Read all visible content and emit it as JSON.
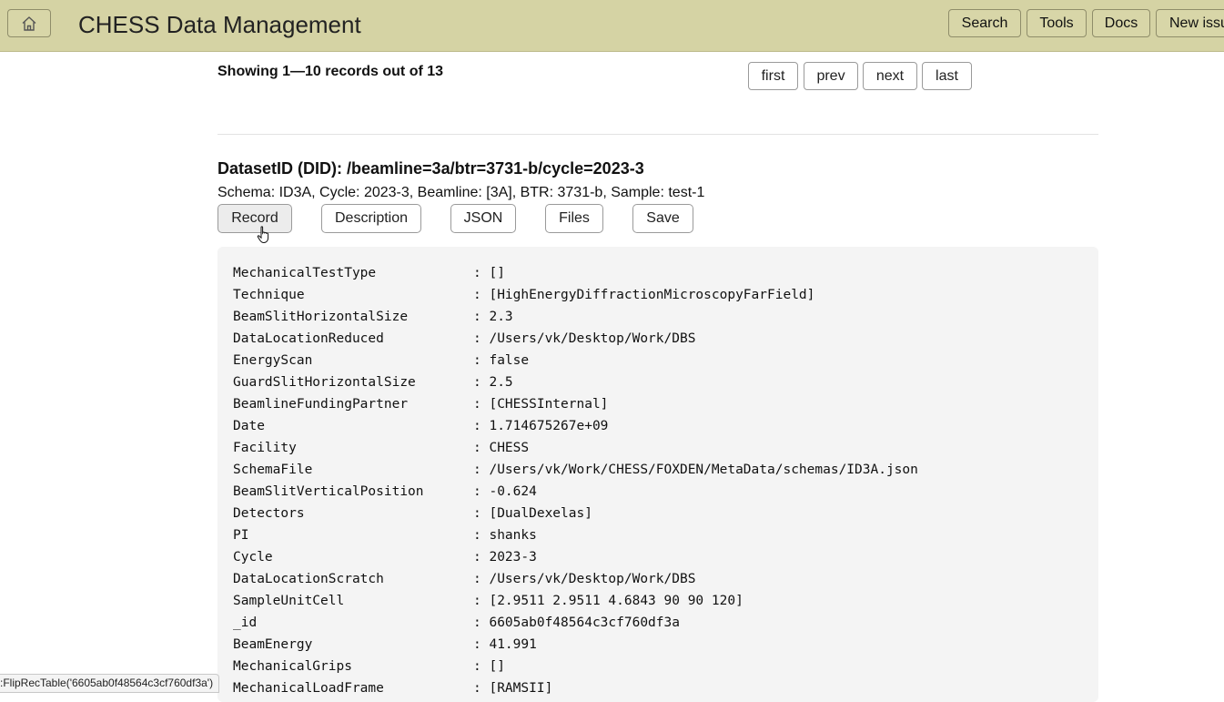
{
  "header": {
    "title": "CHESS Data Management",
    "nav": [
      {
        "label": "Search"
      },
      {
        "label": "Tools"
      },
      {
        "label": "Docs"
      },
      {
        "label": "New issue"
      }
    ]
  },
  "pagination": {
    "showing": "Showing 1—10 records out of 13",
    "first": "first",
    "prev": "prev",
    "next": "next",
    "last": "last"
  },
  "dataset": {
    "did": "DatasetID (DID): /beamline=3a/btr=3731-b/cycle=2023-3",
    "meta": "Schema: ID3A, Cycle: 2023-3, Beamline: [3A], BTR: 3731-b, Sample: test-1",
    "tabs": {
      "record": "Record",
      "description": "Description",
      "json": "JSON",
      "files": "Files",
      "save": "Save"
    },
    "rows": [
      {
        "key": "MechanicalTestType",
        "value": ": []"
      },
      {
        "key": "Technique",
        "value": ": [HighEnergyDiffractionMicroscopyFarField]"
      },
      {
        "key": "BeamSlitHorizontalSize",
        "value": ": 2.3"
      },
      {
        "key": "DataLocationReduced",
        "value": ": /Users/vk/Desktop/Work/DBS"
      },
      {
        "key": "EnergyScan",
        "value": ": false"
      },
      {
        "key": "GuardSlitHorizontalSize",
        "value": ": 2.5"
      },
      {
        "key": "BeamlineFundingPartner",
        "value": ": [CHESSInternal]"
      },
      {
        "key": "Date",
        "value": ": 1.714675267e+09"
      },
      {
        "key": "Facility",
        "value": ": CHESS"
      },
      {
        "key": "SchemaFile",
        "value": ": /Users/vk/Work/CHESS/FOXDEN/MetaData/schemas/ID3A.json"
      },
      {
        "key": "BeamSlitVerticalPosition",
        "value": ": -0.624"
      },
      {
        "key": "Detectors",
        "value": ": [DualDexelas]"
      },
      {
        "key": "PI",
        "value": ": shanks"
      },
      {
        "key": "Cycle",
        "value": ": 2023-3"
      },
      {
        "key": "DataLocationScratch",
        "value": ": /Users/vk/Desktop/Work/DBS"
      },
      {
        "key": "SampleUnitCell",
        "value": ": [2.9511 2.9511 4.6843 90 90 120]"
      },
      {
        "key": "_id",
        "value": ": 6605ab0f48564c3cf760df3a"
      },
      {
        "key": "BeamEnergy",
        "value": ": 41.991"
      },
      {
        "key": "MechanicalGrips",
        "value": ": []"
      },
      {
        "key": "MechanicalLoadFrame",
        "value": ": [RAMSII]"
      }
    ]
  },
  "status_bar": ":FlipRecTable('6605ab0f48564c3cf760df3a')"
}
